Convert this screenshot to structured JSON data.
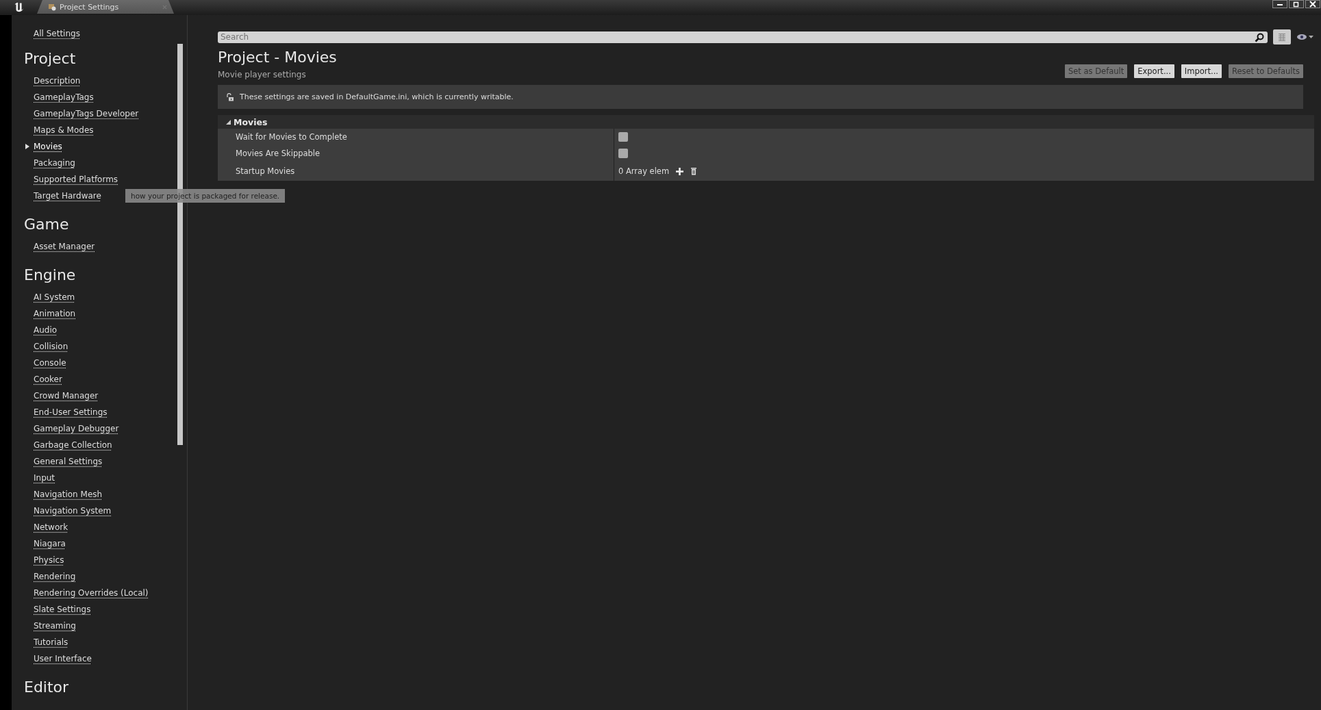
{
  "window": {
    "tab_title": "Project Settings"
  },
  "sidebar": {
    "top_link": "All Settings",
    "sections": [
      {
        "heading": "Project",
        "items": [
          {
            "label": "Description",
            "selected": false
          },
          {
            "label": "GameplayTags",
            "selected": false
          },
          {
            "label": "GameplayTags Developer",
            "selected": false
          },
          {
            "label": "Maps & Modes",
            "selected": false
          },
          {
            "label": "Movies",
            "selected": true
          },
          {
            "label": "Packaging",
            "selected": false
          },
          {
            "label": "Supported Platforms",
            "selected": false
          },
          {
            "label": "Target Hardware",
            "selected": false
          }
        ]
      },
      {
        "heading": "Game",
        "items": [
          {
            "label": "Asset Manager",
            "selected": false
          }
        ]
      },
      {
        "heading": "Engine",
        "items": [
          {
            "label": "AI System",
            "selected": false
          },
          {
            "label": "Animation",
            "selected": false
          },
          {
            "label": "Audio",
            "selected": false
          },
          {
            "label": "Collision",
            "selected": false
          },
          {
            "label": "Console",
            "selected": false
          },
          {
            "label": "Cooker",
            "selected": false
          },
          {
            "label": "Crowd Manager",
            "selected": false
          },
          {
            "label": "End-User Settings",
            "selected": false
          },
          {
            "label": "Gameplay Debugger",
            "selected": false
          },
          {
            "label": "Garbage Collection",
            "selected": false
          },
          {
            "label": "General Settings",
            "selected": false
          },
          {
            "label": "Input",
            "selected": false
          },
          {
            "label": "Navigation Mesh",
            "selected": false
          },
          {
            "label": "Navigation System",
            "selected": false
          },
          {
            "label": "Network",
            "selected": false
          },
          {
            "label": "Niagara",
            "selected": false
          },
          {
            "label": "Physics",
            "selected": false
          },
          {
            "label": "Rendering",
            "selected": false
          },
          {
            "label": "Rendering Overrides (Local)",
            "selected": false
          },
          {
            "label": "Slate Settings",
            "selected": false
          },
          {
            "label": "Streaming",
            "selected": false
          },
          {
            "label": "Tutorials",
            "selected": false
          },
          {
            "label": "User Interface",
            "selected": false
          }
        ]
      },
      {
        "heading": "Editor"
      }
    ]
  },
  "tooltip": "how your project is packaged for release.",
  "search": {
    "placeholder": "Search"
  },
  "page": {
    "title": "Project - Movies",
    "subtitle": "Movie player settings",
    "buttons": [
      {
        "label": "Set as Default",
        "disabled": true
      },
      {
        "label": "Export...",
        "disabled": false
      },
      {
        "label": "Import...",
        "disabled": false
      },
      {
        "label": "Reset to Defaults",
        "disabled": true
      }
    ],
    "notice": "These settings are saved in DefaultGame.ini, which is currently writable."
  },
  "category": {
    "title": "Movies",
    "expanded": true,
    "rows": [
      {
        "kind": "checkbox",
        "name": "Wait for Movies to Complete",
        "checked": false
      },
      {
        "kind": "checkbox",
        "name": "Movies Are Skippable",
        "checked": false
      },
      {
        "kind": "array",
        "name": "Startup Movies",
        "value": "0 Array elem"
      }
    ]
  }
}
